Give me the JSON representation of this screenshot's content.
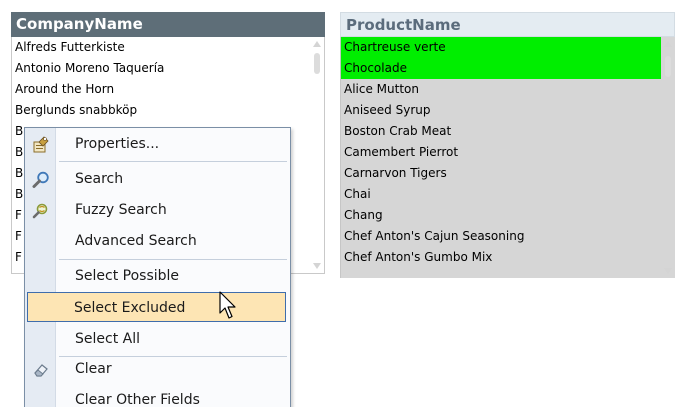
{
  "company_listbox": {
    "header": "CompanyName",
    "rows": [
      "Alfreds Futterkiste",
      "Antonio Moreno Taquería",
      "Around the Horn",
      "Berglunds snabbköp",
      "B",
      "B",
      "B",
      "B",
      "F",
      "F",
      "F"
    ]
  },
  "product_listbox": {
    "header": "ProductName",
    "rows": [
      {
        "text": "Chartreuse verte",
        "state": "possible"
      },
      {
        "text": "Chocolade",
        "state": "possible"
      },
      {
        "text": "Alice Mutton",
        "state": "excluded"
      },
      {
        "text": "Aniseed Syrup",
        "state": "excluded"
      },
      {
        "text": "Boston Crab Meat",
        "state": "excluded"
      },
      {
        "text": "Camembert Pierrot",
        "state": "excluded"
      },
      {
        "text": "Carnarvon Tigers",
        "state": "excluded"
      },
      {
        "text": "Chai",
        "state": "excluded"
      },
      {
        "text": "Chang",
        "state": "excluded"
      },
      {
        "text": "Chef Anton's Cajun Seasoning",
        "state": "excluded"
      },
      {
        "text": "Chef Anton's Gumbo Mix",
        "state": "excluded"
      }
    ]
  },
  "context_menu": {
    "items": [
      {
        "label": "Properties...",
        "icon": "properties-icon"
      },
      {
        "label": "Search",
        "icon": "search-icon"
      },
      {
        "label": "Fuzzy Search",
        "icon": "fuzzy-search-icon"
      },
      {
        "label": "Advanced Search",
        "icon": ""
      },
      {
        "label": "Select Possible",
        "icon": ""
      },
      {
        "label": "Select Excluded",
        "icon": "",
        "highlighted": true
      },
      {
        "label": "Select All",
        "icon": ""
      },
      {
        "label": "Clear",
        "icon": "eraser-icon"
      },
      {
        "label": "Clear Other Fields",
        "icon": ""
      }
    ]
  },
  "colors": {
    "possible": "#00ee00",
    "excluded": "#d6d6d6",
    "company_header_bg": "#5e6e78",
    "product_header_bg": "#e4ecf2",
    "menu_highlight": "#fde5b4"
  }
}
